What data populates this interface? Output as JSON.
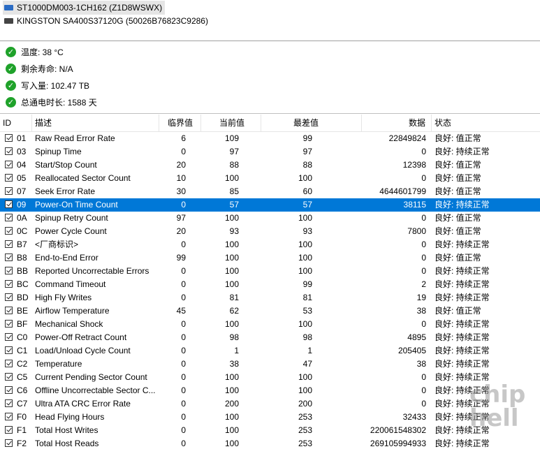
{
  "drives": [
    {
      "label": "ST1000DM003-1CH162 (Z1D8WSWX)",
      "selected": true,
      "icon": "hdd-icon",
      "icon_color": "#2b6cc4"
    },
    {
      "label": "KINGSTON SA400S37120G (50026B76823C9286)",
      "selected": false,
      "icon": "ssd-icon",
      "icon_color": "#444444"
    }
  ],
  "summary": [
    {
      "label": "温度: 38 °C"
    },
    {
      "label": "剩余寿命: N/A"
    },
    {
      "label": "写入量: 102.47 TB"
    },
    {
      "label": "总通电时长: 1588 天"
    }
  ],
  "table": {
    "headers": {
      "id": "ID",
      "desc": "描述",
      "threshold": "临界值",
      "current": "当前值",
      "worst": "最差值",
      "raw": "数据",
      "status": "状态"
    },
    "rows": [
      {
        "id": "01",
        "desc": "Raw Read Error Rate",
        "threshold": "6",
        "current": "109",
        "worst": "99",
        "raw": "22849824",
        "status": "良好: 值正常"
      },
      {
        "id": "03",
        "desc": "Spinup Time",
        "threshold": "0",
        "current": "97",
        "worst": "97",
        "raw": "0",
        "status": "良好: 持续正常"
      },
      {
        "id": "04",
        "desc": "Start/Stop Count",
        "threshold": "20",
        "current": "88",
        "worst": "88",
        "raw": "12398",
        "status": "良好: 值正常"
      },
      {
        "id": "05",
        "desc": "Reallocated Sector Count",
        "threshold": "10",
        "current": "100",
        "worst": "100",
        "raw": "0",
        "status": "良好: 值正常"
      },
      {
        "id": "07",
        "desc": "Seek Error Rate",
        "threshold": "30",
        "current": "85",
        "worst": "60",
        "raw": "4644601799",
        "status": "良好: 值正常"
      },
      {
        "id": "09",
        "desc": "Power-On Time Count",
        "threshold": "0",
        "current": "57",
        "worst": "57",
        "raw": "38115",
        "status": "良好: 持续正常",
        "selected": true
      },
      {
        "id": "0A",
        "desc": "Spinup Retry Count",
        "threshold": "97",
        "current": "100",
        "worst": "100",
        "raw": "0",
        "status": "良好: 值正常"
      },
      {
        "id": "0C",
        "desc": "Power Cycle Count",
        "threshold": "20",
        "current": "93",
        "worst": "93",
        "raw": "7800",
        "status": "良好: 值正常"
      },
      {
        "id": "B7",
        "desc": "<厂商标识>",
        "threshold": "0",
        "current": "100",
        "worst": "100",
        "raw": "0",
        "status": "良好: 持续正常"
      },
      {
        "id": "B8",
        "desc": "End-to-End Error",
        "threshold": "99",
        "current": "100",
        "worst": "100",
        "raw": "0",
        "status": "良好: 值正常"
      },
      {
        "id": "BB",
        "desc": "Reported Uncorrectable Errors",
        "threshold": "0",
        "current": "100",
        "worst": "100",
        "raw": "0",
        "status": "良好: 持续正常"
      },
      {
        "id": "BC",
        "desc": "Command Timeout",
        "threshold": "0",
        "current": "100",
        "worst": "99",
        "raw": "2",
        "status": "良好: 持续正常"
      },
      {
        "id": "BD",
        "desc": "High Fly Writes",
        "threshold": "0",
        "current": "81",
        "worst": "81",
        "raw": "19",
        "status": "良好: 持续正常"
      },
      {
        "id": "BE",
        "desc": "Airflow Temperature",
        "threshold": "45",
        "current": "62",
        "worst": "53",
        "raw": "38",
        "status": "良好: 值正常"
      },
      {
        "id": "BF",
        "desc": "Mechanical Shock",
        "threshold": "0",
        "current": "100",
        "worst": "100",
        "raw": "0",
        "status": "良好: 持续正常"
      },
      {
        "id": "C0",
        "desc": "Power-Off Retract Count",
        "threshold": "0",
        "current": "98",
        "worst": "98",
        "raw": "4895",
        "status": "良好: 持续正常"
      },
      {
        "id": "C1",
        "desc": "Load/Unload Cycle Count",
        "threshold": "0",
        "current": "1",
        "worst": "1",
        "raw": "205405",
        "status": "良好: 持续正常"
      },
      {
        "id": "C2",
        "desc": "Temperature",
        "threshold": "0",
        "current": "38",
        "worst": "47",
        "raw": "38",
        "status": "良好: 持续正常"
      },
      {
        "id": "C5",
        "desc": "Current Pending Sector Count",
        "threshold": "0",
        "current": "100",
        "worst": "100",
        "raw": "0",
        "status": "良好: 持续正常"
      },
      {
        "id": "C6",
        "desc": "Offline Uncorrectable Sector C...",
        "threshold": "0",
        "current": "100",
        "worst": "100",
        "raw": "0",
        "status": "良好: 持续正常"
      },
      {
        "id": "C7",
        "desc": "Ultra ATA CRC Error Rate",
        "threshold": "0",
        "current": "200",
        "worst": "200",
        "raw": "0",
        "status": "良好: 持续正常"
      },
      {
        "id": "F0",
        "desc": "Head Flying Hours",
        "threshold": "0",
        "current": "100",
        "worst": "253",
        "raw": "32433",
        "status": "良好: 持续正常"
      },
      {
        "id": "F1",
        "desc": "Total Host Writes",
        "threshold": "0",
        "current": "100",
        "worst": "253",
        "raw": "220061548302",
        "status": "良好: 持续正常"
      },
      {
        "id": "F2",
        "desc": "Total Host Reads",
        "threshold": "0",
        "current": "100",
        "worst": "253",
        "raw": "269105994933",
        "status": "良好: 持续正常"
      }
    ]
  },
  "watermark": "chiphell",
  "colors": {
    "selection": "#0078d7",
    "ok": "#1fa22a"
  }
}
